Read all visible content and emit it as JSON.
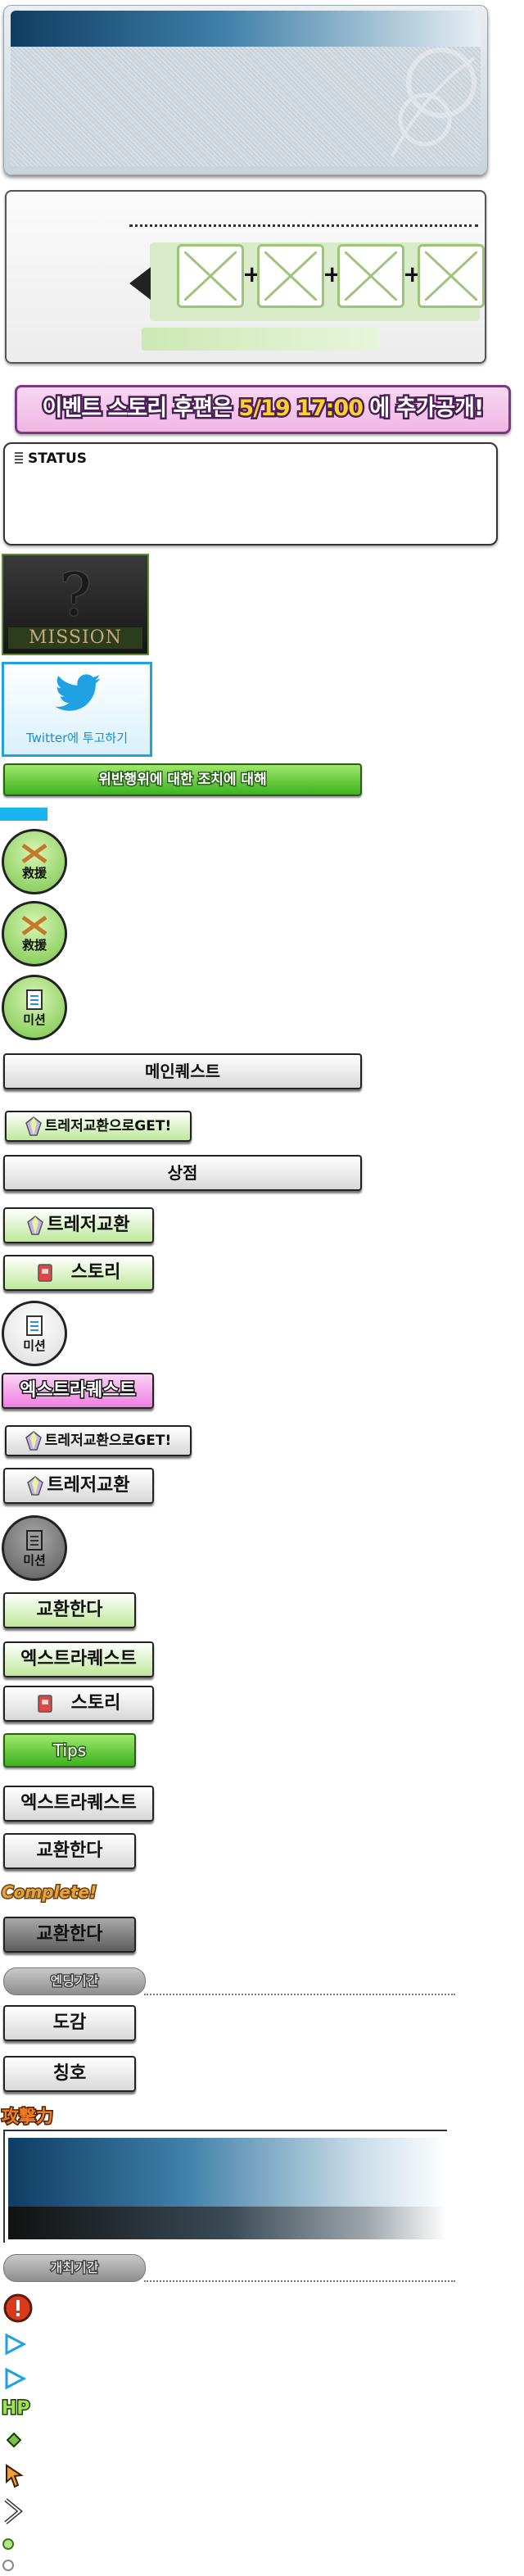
{
  "banner": {
    "part1": "이벤트 스토리 후편은 ",
    "date": "5/19 17:00",
    "part2": " 에 추가공개!"
  },
  "status": {
    "label": "STATUS"
  },
  "mission_image": {
    "label": "MISSION"
  },
  "twitter": {
    "label": "Twitter에 투고하기"
  },
  "buttons": {
    "violation": "위반행위에 대한 조치에 대해",
    "rescue1": "救援",
    "rescue2": "救援",
    "mission1": "미션",
    "main_quest": "메인퀘스트",
    "treasure_get1": "트레저교환으로GET!",
    "shop": "상점",
    "treasure_exchange1": "트레저교환",
    "story1": "스토리",
    "mission2": "미션",
    "extra_quest_pink": "엑스트라퀘스트",
    "treasure_get2": "트레저교환으로GET!",
    "treasure_exchange2": "트레저교환",
    "mission3": "미션",
    "exchange_green": "교환한다",
    "extra_quest_green": "엑스트라퀘스트",
    "story2": "스토리",
    "tips": "Tips",
    "extra_quest_white": "엑스트라퀘스트",
    "exchange_white": "교환한다",
    "complete": "Complete!",
    "exchange_gray": "교환한다",
    "ending_period": "엔딩기간",
    "encyclopedia": "도감",
    "title": "칭호",
    "attack": "攻撃力",
    "event_period": "개최기간",
    "hp": "HP"
  },
  "colors": {
    "accent_green": "#3cb21e",
    "accent_pink": "#ee7ee0",
    "twitter_blue": "#1fa1e3",
    "banner_yellow": "#ffcf2e"
  }
}
